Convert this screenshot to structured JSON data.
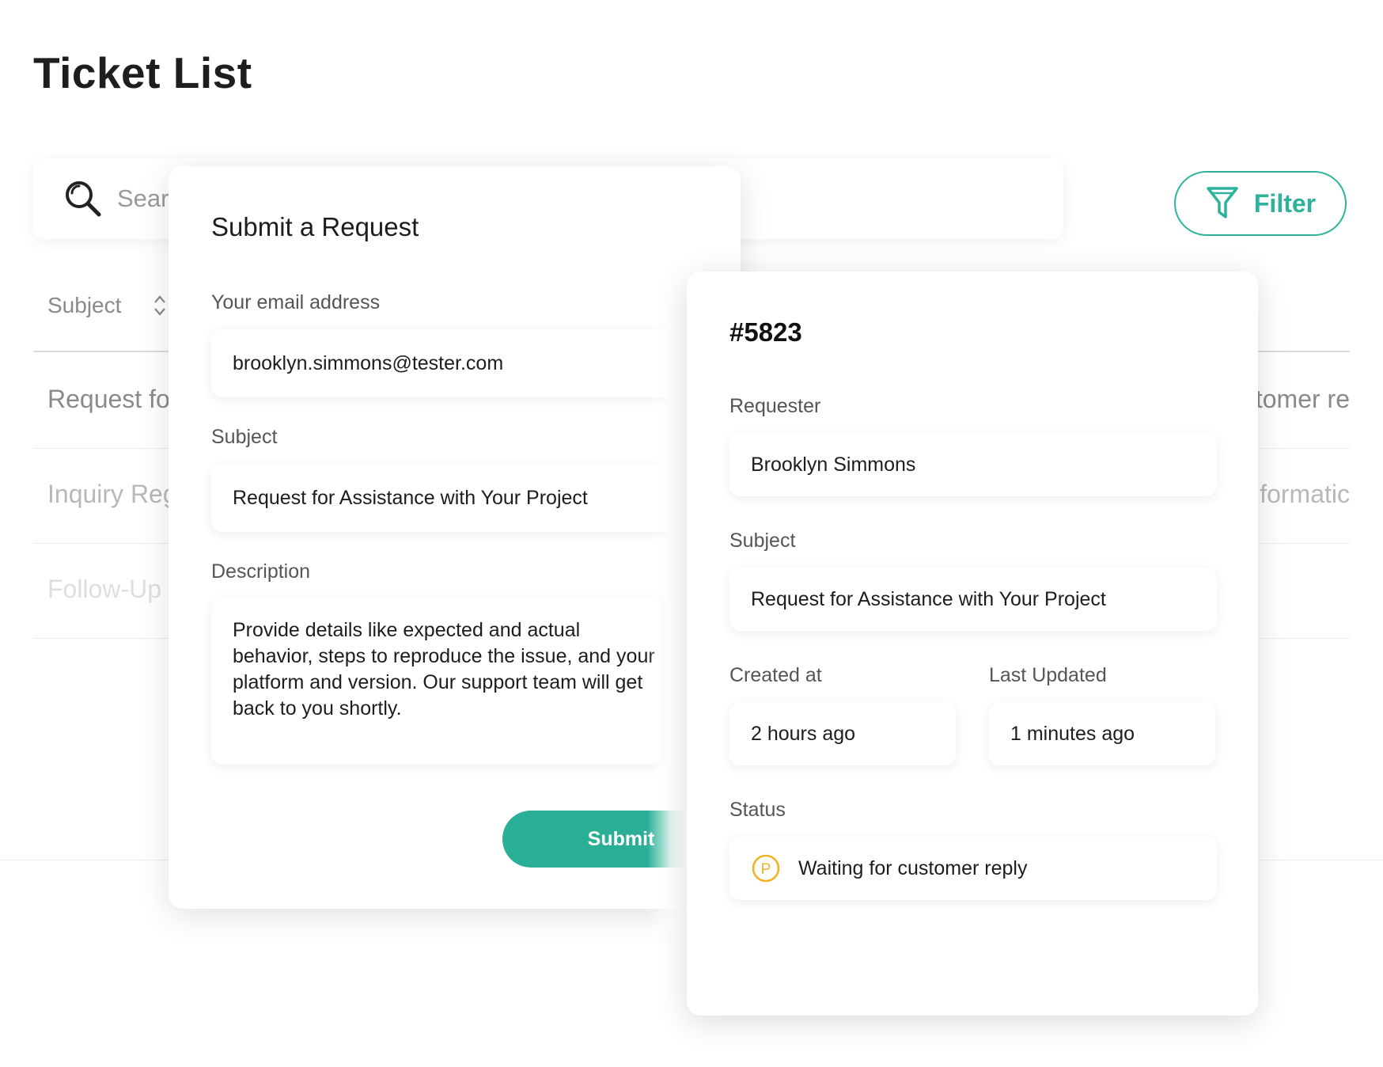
{
  "page": {
    "title": "Ticket List"
  },
  "search": {
    "placeholder": "Search"
  },
  "filter": {
    "label": "Filter"
  },
  "table": {
    "column_header": "Subject",
    "rows": [
      {
        "left": "Request fo",
        "right": "tomer re",
        "color": "#8a8a8a"
      },
      {
        "left": "Inquiry Reg",
        "right": "nformatic",
        "color": "#b8b8b8"
      },
      {
        "left": "Follow-Up",
        "right": "",
        "color": "#dedede"
      }
    ]
  },
  "submit_form": {
    "title": "Submit a Request",
    "email_label": "Your email address",
    "email_value": "brooklyn.simmons@tester.com",
    "subject_label": "Subject",
    "subject_value": "Request for Assistance with Your Project",
    "description_label": "Description",
    "description_value": "Provide details like expected and actual behavior, steps to reproduce the issue, and your platform and version. Our support team will get back to you shortly.",
    "submit_label": "Submit"
  },
  "ticket": {
    "id": "#5823",
    "requester_label": "Requester",
    "requester_value": "Brooklyn Simmons",
    "subject_label": "Subject",
    "subject_value": "Request for Assistance with Your Project",
    "created_label": "Created at",
    "created_value": "2 hours ago",
    "updated_label": "Last Updated",
    "updated_value": "1 minutes ago",
    "status_label": "Status",
    "status_value": "Waiting for customer reply",
    "status_icon_letter": "P",
    "status_color": "#f0b323"
  },
  "colors": {
    "accent": "#2db39b"
  }
}
